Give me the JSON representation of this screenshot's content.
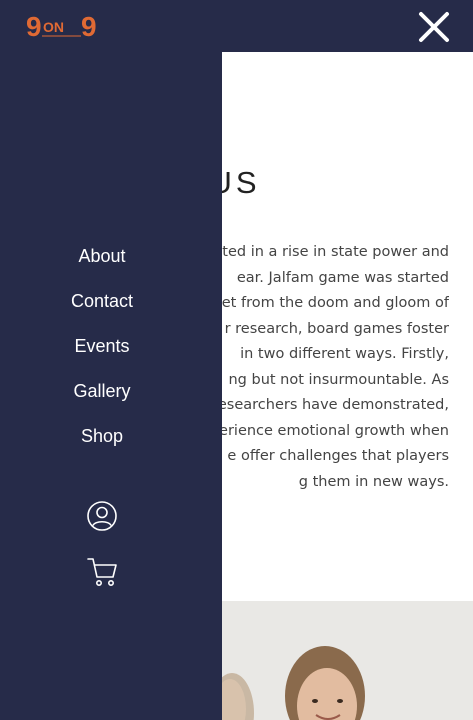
{
  "header": {
    "logo_text": "9on9",
    "close_icon": "close-icon"
  },
  "main": {
    "heading": "OUT US",
    "lines": [
      "ulted in a rise in state power and",
      "ear. Jalfam game was started",
      "let from the doom and gloom of",
      "r research, board games foster",
      "in two different ways. Firstly,",
      "ng but not insurmountable. As",
      "esearchers have demonstrated,",
      "erience emotional growth when",
      "e offer challenges that players",
      "g them in new ways."
    ]
  },
  "menu": {
    "items": [
      {
        "label": "About"
      },
      {
        "label": "Contact"
      },
      {
        "label": "Events"
      },
      {
        "label": "Gallery"
      },
      {
        "label": "Shop"
      }
    ],
    "account_icon": "user-circle-icon",
    "cart_icon": "shopping-cart-icon"
  },
  "colors": {
    "navy": "#262b49",
    "logo_orange": "#e06a34",
    "text_dark": "#222222",
    "text_body": "#444444"
  }
}
